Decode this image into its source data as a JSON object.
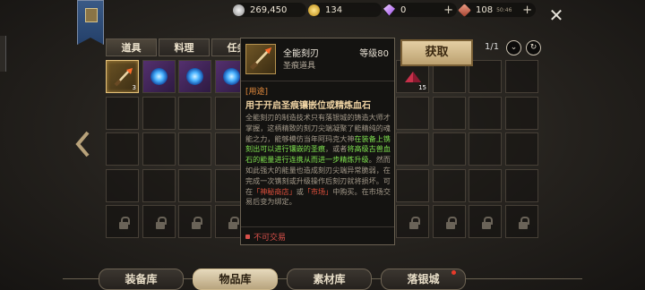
{
  "currencies": [
    {
      "icon": "silver-coin-icon",
      "value": "269,450",
      "color": "#c8c8c8"
    },
    {
      "icon": "gold-coin-icon",
      "value": "134",
      "color": "#e0b43a"
    },
    {
      "icon": "diamond-icon",
      "value": "0",
      "color": "#c27cff"
    },
    {
      "icon": "stamina-ticket-icon",
      "value": "108",
      "sub": "50:46",
      "color": "#d86a52"
    }
  ],
  "tabs": [
    {
      "label": "道具"
    },
    {
      "label": "料理"
    },
    {
      "label": "任务"
    }
  ],
  "pager": "1/1",
  "item_grid": {
    "slots": [
      {
        "type": "dagger",
        "count": "3",
        "selected": true
      },
      {
        "type": "blue-orb"
      },
      {
        "type": "blue-orb"
      },
      {
        "type": "blue-orb"
      },
      {
        "type": "red-crystal",
        "count": "15"
      }
    ]
  },
  "tooltip": {
    "name": "全能刻刃",
    "category": "圣痕道具",
    "level": "等级80",
    "tag": "[用途]",
    "usage": "用于开启圣痕镶嵌位或精炼血石",
    "desc_part1": "全能刻刃的制造技术只有落银城的铸造大师才掌握，这柄精致的刻刀尖端凝聚了能精纯的魂能之力，能够模仿当年阿玛克大神",
    "desc_green1": "在装备上镌刻出可以进行镶嵌的圣痕",
    "desc_part2": "，或者",
    "desc_green2": "将高级古兽血石的能量进行连携从而进一步精炼升级",
    "desc_part3": "。然而如此强大的能量也造成刻刃尖端异常脆弱，在完成一次镌刻或升级操作后刻刃就将损坏。可在",
    "desc_red1": "「神秘商店」",
    "desc_part4": "或",
    "desc_red2": "「市场」",
    "desc_part5": "中购买。在市场交易后变为绑定。",
    "trade": "不可交易"
  },
  "get_button": "获取",
  "bottom_nav": [
    {
      "label": "装备库"
    },
    {
      "label": "物品库"
    },
    {
      "label": "素材库"
    },
    {
      "label": "落银城"
    }
  ]
}
